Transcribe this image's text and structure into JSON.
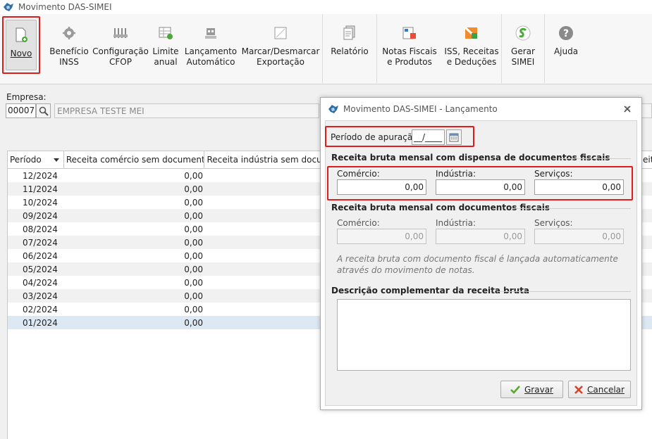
{
  "window": {
    "title": "Movimento DAS-SIMEI"
  },
  "toolbar": {
    "items": [
      {
        "label": "Novo"
      },
      {
        "label": "Benefício\nINSS"
      },
      {
        "label": "Configuração\nCFOP"
      },
      {
        "label": "Limite\nanual"
      },
      {
        "label": "Lançamento\nAutomático"
      },
      {
        "label": "Marcar/Desmarcar\nExportação"
      },
      {
        "label": "Relatório"
      },
      {
        "label": "Notas Fiscais\ne Produtos"
      },
      {
        "label": "ISS, Receitas\ne Deduções"
      },
      {
        "label": "Gerar\nSIMEI"
      },
      {
        "label": "Ajuda"
      }
    ]
  },
  "empresa": {
    "label": "Empresa:",
    "code": "00007",
    "name": "EMPRESA TESTE MEI"
  },
  "grid": {
    "columns": [
      "Período",
      "Receita comércio sem documento",
      "Receita indústria sem documen",
      "eita"
    ],
    "rows": [
      {
        "periodo": "12/2024",
        "valor": "0,00"
      },
      {
        "periodo": "11/2024",
        "valor": "0,00"
      },
      {
        "periodo": "10/2024",
        "valor": "0,00"
      },
      {
        "periodo": "09/2024",
        "valor": "0,00"
      },
      {
        "periodo": "08/2024",
        "valor": "0,00"
      },
      {
        "periodo": "07/2024",
        "valor": "0,00"
      },
      {
        "periodo": "06/2024",
        "valor": "0,00"
      },
      {
        "periodo": "05/2024",
        "valor": "0,00"
      },
      {
        "periodo": "04/2024",
        "valor": "0,00"
      },
      {
        "periodo": "03/2024",
        "valor": "0,00"
      },
      {
        "periodo": "02/2024",
        "valor": "0,00"
      },
      {
        "periodo": "01/2024",
        "valor": "0,00"
      }
    ],
    "selected_row": "01/2024"
  },
  "dialog": {
    "title": "Movimento DAS-SIMEI - Lançamento",
    "periodo_label": "Período de apuração:",
    "periodo_value": "__/____",
    "sec1_title": "Receita bruta mensal com dispensa de documentos fiscais",
    "sec2_title": "Receita bruta mensal com documentos fiscais",
    "comercio_label": "Comércio:",
    "industria_label": "Indústria:",
    "servicos_label": "Serviços:",
    "sec1_values": {
      "comercio": "0,00",
      "industria": "0,00",
      "servicos": "0,00"
    },
    "sec2_values": {
      "comercio": "0,00",
      "industria": "0,00",
      "servicos": "0,00"
    },
    "note": "A receita bruta com documento fiscal é lançada automaticamente através do movimento de notas.",
    "descricao_title": "Descrição complementar da receita bruta",
    "descricao_value": "",
    "save_label": "Gravar",
    "cancel_label": "Cancelar"
  },
  "colors": {
    "highlight_red": "#e01c1c",
    "selected_row": "#dde8f5"
  }
}
